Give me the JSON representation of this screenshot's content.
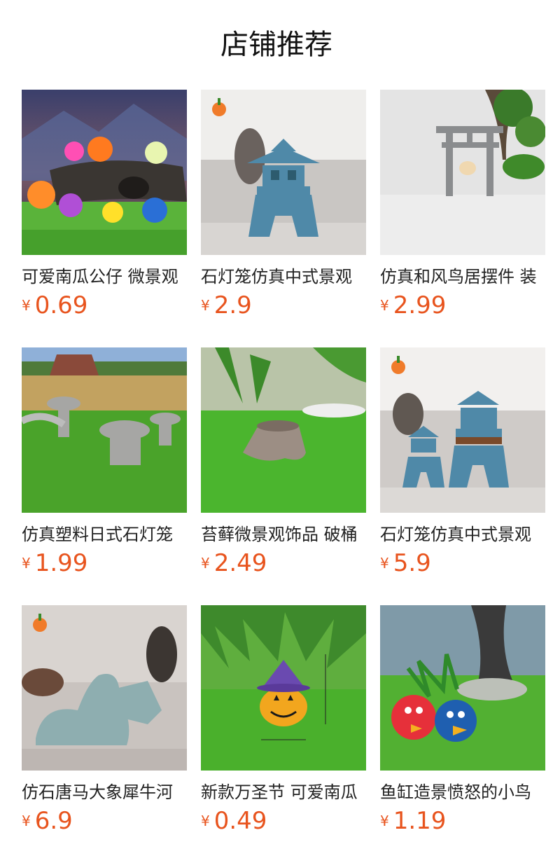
{
  "header": {
    "title": "店铺推荐"
  },
  "currency_symbol": "¥",
  "products": [
    {
      "name": "可爱南瓜公仔 微景观",
      "price": "0.69",
      "image": "cute-pumpkin-figurines"
    },
    {
      "name": "石灯笼仿真中式景观",
      "price": "2.9",
      "image": "stone-lantern-pagoda"
    },
    {
      "name": "仿真和风鸟居摆件 装",
      "price": "2.99",
      "image": "torii-gate"
    },
    {
      "name": "仿真塑料日式石灯笼",
      "price": "1.99",
      "image": "japanese-stone-lanterns"
    },
    {
      "name": "苔藓微景观饰品 破桶",
      "price": "2.49",
      "image": "tree-stump"
    },
    {
      "name": "石灯笼仿真中式景观",
      "price": "5.9",
      "image": "stone-lantern-pair"
    },
    {
      "name": "仿石唐马大象犀牛河",
      "price": "6.9",
      "image": "stone-horse-animals"
    },
    {
      "name": "新款万圣节 可爱南瓜",
      "price": "0.49",
      "image": "halloween-pumpkin"
    },
    {
      "name": "鱼缸造景愤怒的小鸟",
      "price": "1.19",
      "image": "angry-birds"
    }
  ]
}
